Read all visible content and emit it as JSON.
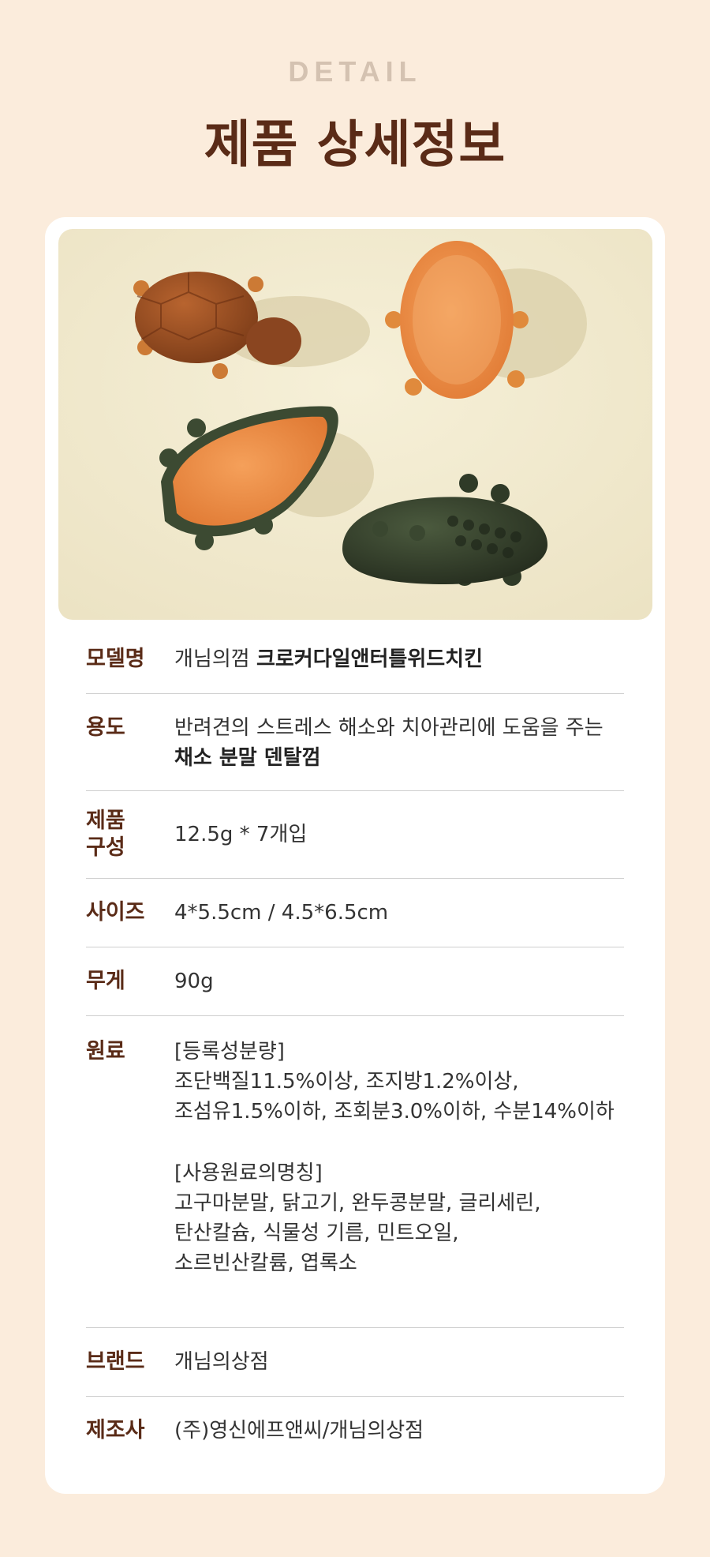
{
  "header": {
    "eyebrow": "DETAIL",
    "title": "제품 상세정보"
  },
  "photo": {
    "alt_items": [
      "turtle-chew-brown",
      "turtle-chew-orange",
      "crocodile-chew-flat",
      "crocodile-chew-green"
    ]
  },
  "specs": {
    "model": {
      "label": "모델명",
      "value_plain": "개님의껌",
      "value_bold": "크로커다일앤터틀위드치킨"
    },
    "use": {
      "label": "용도",
      "line1": "반려견의 스트레스 해소와 치아관리에 도움을 주는",
      "line2_bold": "채소 분말 덴탈껌"
    },
    "composition": {
      "label_line1": "제품",
      "label_line2": "구성",
      "value": "12.5g * 7개입"
    },
    "size": {
      "label": "사이즈",
      "value": "4*5.5cm / 4.5*6.5cm"
    },
    "weight": {
      "label": "무게",
      "value": "90g"
    },
    "ingredients": {
      "label": "원료",
      "lines": [
        "[등록성분량]",
        "조단백질11.5%이상, 조지방1.2%이상,",
        "조섬유1.5%이하, 조회분3.0%이하, 수분14%이하",
        "[사용원료의명칭]",
        "고구마분말, 닭고기, 완두콩분말, 글리세린,",
        "탄산칼슘, 식물성 기름, 민트오일,",
        "소르빈산칼륨, 엽록소"
      ]
    },
    "brand": {
      "label": "브랜드",
      "value": "개님의상점"
    },
    "maker": {
      "label": "제조사",
      "value": "(주)영신에프앤씨/개님의상점"
    }
  },
  "colors": {
    "background": "#fbecdc",
    "accent": "#5a2b17",
    "eyebrow": "#d4c2b1"
  }
}
